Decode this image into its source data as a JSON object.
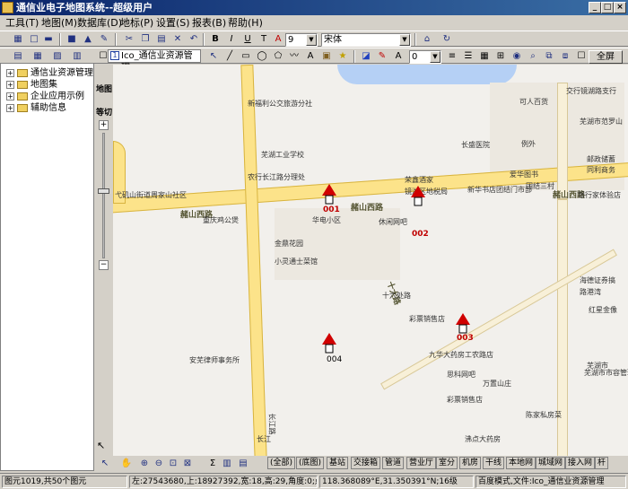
{
  "window": {
    "title": "通信业电子地图系统--超级用户",
    "buttons": [
      "_",
      "□",
      "×"
    ]
  },
  "menu": [
    "工具(T)",
    "地图(M)",
    "数据库(D)",
    "地标(P)",
    "设置(S)",
    "报表(B)",
    "帮助(H)"
  ],
  "toolbar": {
    "font_size": "9",
    "font_name": "宋体"
  },
  "toolbar2": {
    "line_width": "0",
    "fullscreen_label": "全屏"
  },
  "tree": {
    "items": [
      "通信业资源管理",
      "地图集",
      "企业应用示例",
      "辅助信息"
    ]
  },
  "map_tab": {
    "label": "Ico_通信业资源管理"
  },
  "side_labels": {
    "map_label": "地图",
    "zoom_label": "等切"
  },
  "map": {
    "pois": [
      "新福利公交旅游分社",
      "芜湖工业学校",
      "农行长江路分理处",
      "荣鑫酒家",
      "镜湖区地税局",
      "新华书店团结门市部",
      "团结三村",
      "长盛医院",
      "华电小区",
      "重庆鸡公煲",
      "休闲网吧",
      "金鼎花园",
      "小灵通士菜馆",
      "彩票销售店",
      "九华大药房工农路店",
      "思科网吧",
      "彩票销售店",
      "安芜律师事务所",
      "陈家私房菜",
      "沸点大药房",
      "长江路",
      "可人百货",
      "交行镜湖路支行",
      "芜湖市范罗山",
      "例外",
      "邮政储蓄",
      "同利商务",
      "爱华图书",
      "银行家体验店",
      "红星金像",
      "芜湖市市容管理局",
      "弋矶山街道周家山社区",
      "海德证券搞",
      "路港湾",
      "长江",
      "十六处路",
      "万置山庄",
      "芜湖市"
    ],
    "roads": [
      "赭山西路",
      "赭山西路",
      "赭山西路",
      "十大路"
    ],
    "markers": [
      "001",
      "002",
      "003",
      "004"
    ]
  },
  "bottom_tabs": [
    "(全部)",
    "(底图)",
    "基站",
    "交接箱",
    "管道",
    "营业厅",
    "室分",
    "机房",
    "干线",
    "本地网",
    "城域网",
    "接入网",
    "杆"
  ],
  "status": {
    "left": "图元1019,共50个图元",
    "coords": "左:27543680,上:18927392,宽:18,高:29,角度:0;点:未选中",
    "lonlat": "118.368089°E,31.350391°N;16级",
    "mode": "百度模式,文件:Ico_通信业资源管理"
  }
}
